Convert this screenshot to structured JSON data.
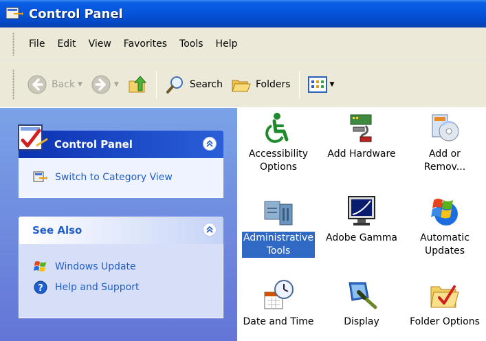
{
  "window": {
    "title": "Control Panel"
  },
  "menu": [
    "File",
    "Edit",
    "View",
    "Favorites",
    "Tools",
    "Help"
  ],
  "toolbar": {
    "back_label": "Back",
    "search_label": "Search",
    "folders_label": "Folders"
  },
  "taskpane": {
    "control_panel_box": {
      "title": "Control Panel",
      "link": "Switch to Category View"
    },
    "see_also_box": {
      "title": "See Also",
      "links": [
        "Windows Update",
        "Help and Support"
      ]
    }
  },
  "items": [
    {
      "label_line1": "Accessibility",
      "label_line2": "Options",
      "icon": "accessibility-icon"
    },
    {
      "label_line1": "Add Hardware",
      "label_line2": "",
      "icon": "add-hardware-icon"
    },
    {
      "label_line1": "Add or",
      "label_line2": "Remov...",
      "icon": "add-remove-programs-icon"
    },
    {
      "label_line1": "Administrative",
      "label_line2": "Tools",
      "icon": "administrative-tools-icon",
      "selected": true
    },
    {
      "label_line1": "Adobe Gamma",
      "label_line2": "",
      "icon": "adobe-gamma-icon"
    },
    {
      "label_line1": "Automatic",
      "label_line2": "Updates",
      "icon": "automatic-updates-icon"
    },
    {
      "label_line1": "Date and Time",
      "label_line2": "",
      "icon": "date-time-icon"
    },
    {
      "label_line1": "Display",
      "label_line2": "",
      "icon": "display-icon"
    },
    {
      "label_line1": "Folder Options",
      "label_line2": "",
      "icon": "folder-options-icon"
    }
  ],
  "colors": {
    "titlebar": "#0553d9",
    "taskpane": "#6f8ddf",
    "link": "#215dc6",
    "selection": "#316ac5"
  }
}
